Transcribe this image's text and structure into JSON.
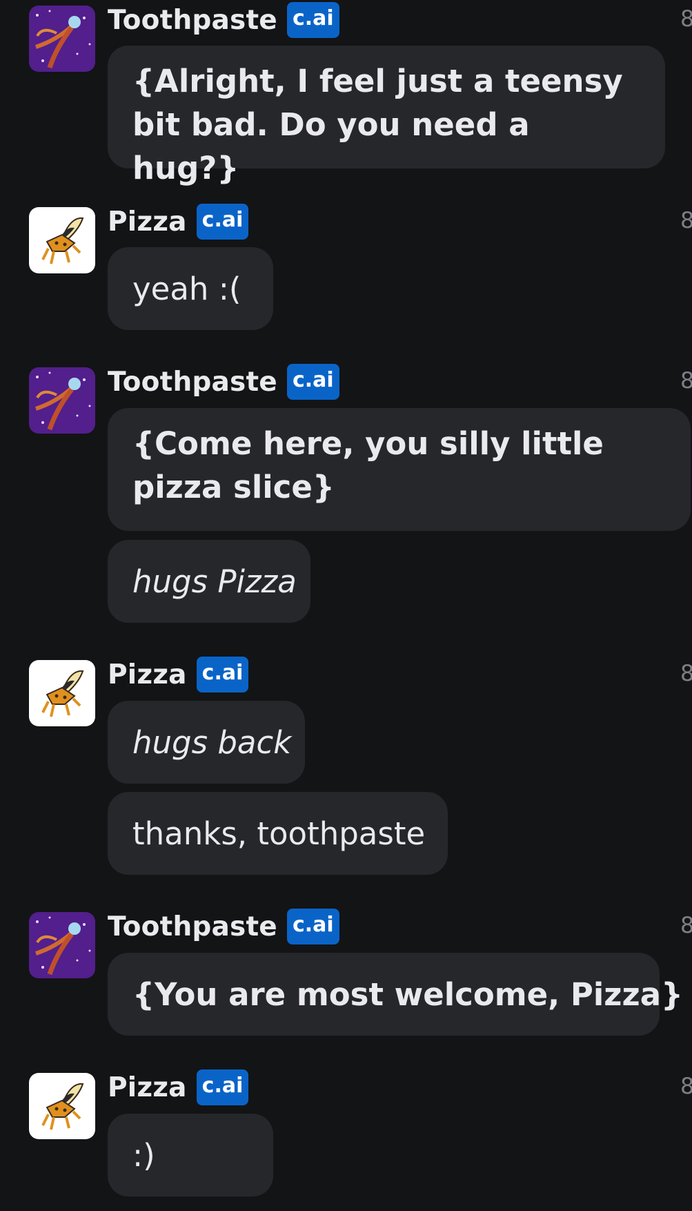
{
  "badge_label": "c.ai",
  "messages": [
    {
      "sender": "Toothpaste",
      "timestamp": "8",
      "bubbles": [
        "{Alright, I feel just a teensy bit bad. Do you need a hug?}"
      ]
    },
    {
      "sender": "Pizza",
      "timestamp": "8",
      "bubbles": [
        "yeah :("
      ]
    },
    {
      "sender": "Toothpaste",
      "timestamp": "8",
      "bubbles": [
        "{Come here, you silly little pizza slice}",
        "hugs Pizza"
      ]
    },
    {
      "sender": "Pizza",
      "timestamp": "8",
      "bubbles": [
        "hugs back",
        "thanks, toothpaste"
      ]
    },
    {
      "sender": "Toothpaste",
      "timestamp": "8",
      "bubbles": [
        "{You are most welcome, Pizza}"
      ]
    },
    {
      "sender": "Pizza",
      "timestamp": "8",
      "bubbles": [
        ":)"
      ]
    }
  ],
  "colors": {
    "background": "#131416",
    "bubble": "#26272b",
    "badge": "#0a64c8",
    "text": "#e9e9ee",
    "timestamp": "#7e7f84"
  },
  "icons": {
    "toothpaste_avatar": "space-creature-avatar-icon",
    "pizza_avatar": "pizza-creature-avatar-icon"
  }
}
